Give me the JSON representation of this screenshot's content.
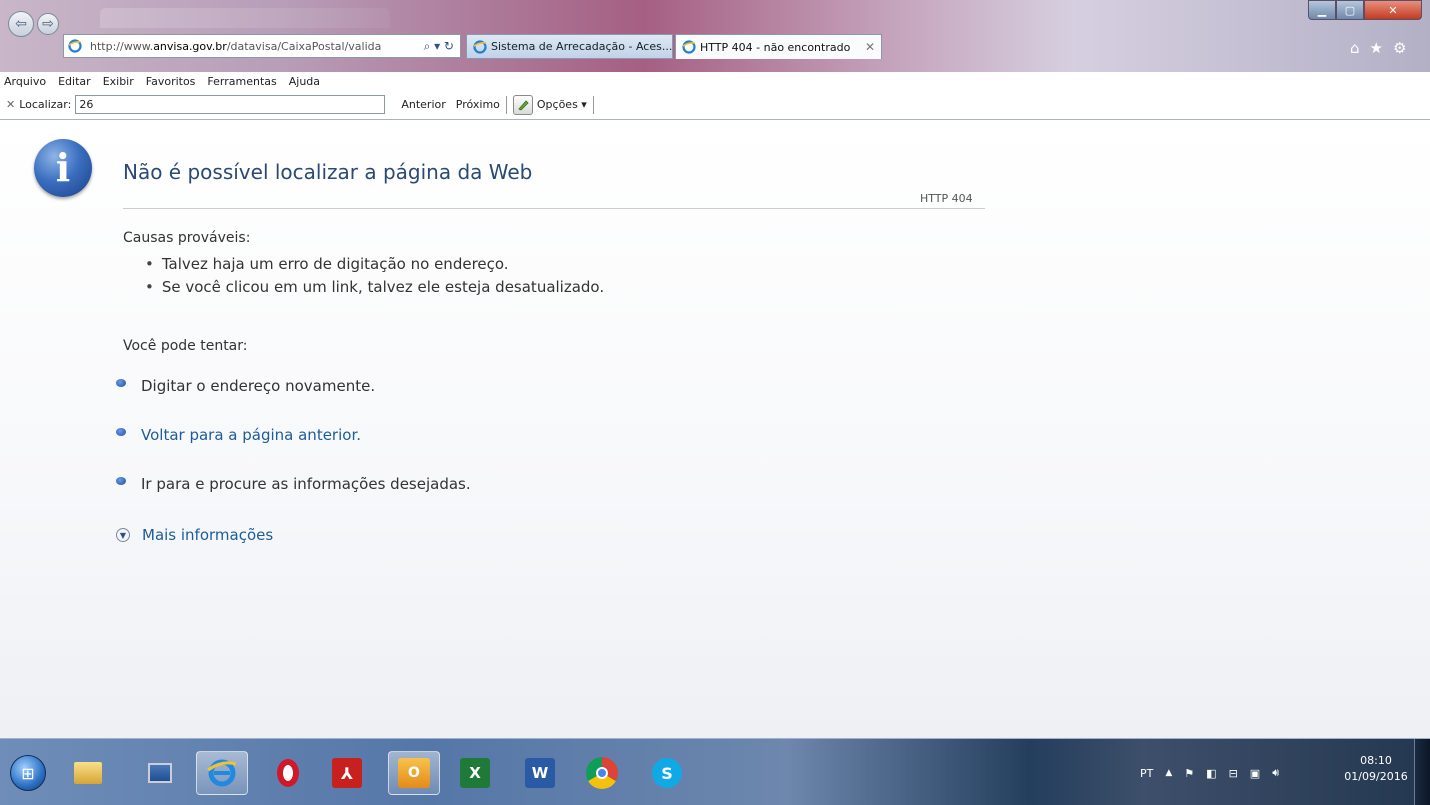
{
  "browser": {
    "address_url_prefix": "http://www.",
    "address_url_domain": "anvisa.gov.br",
    "address_url_path": "/datavisa/CaixaPostal/valida",
    "address_controls": "⌕ ▾ ↻",
    "tabs": [
      {
        "title": "Sistema de Arrecadação - Aces...",
        "active": false
      },
      {
        "title": "HTTP 404 - não encontrado",
        "active": true
      }
    ],
    "tab_close_glyph": "✕",
    "toolbar_icons": [
      "home-icon",
      "favorites-star-icon",
      "tools-gear-icon"
    ]
  },
  "menu": {
    "items": [
      "Arquivo",
      "Editar",
      "Exibir",
      "Favoritos",
      "Ferramentas",
      "Ajuda"
    ]
  },
  "findbar": {
    "label": "Localizar:",
    "value": "26",
    "previous": "Anterior",
    "next": "Próximo",
    "options": "Opções ▾"
  },
  "error_page": {
    "title": "Não é possível localizar a página da Web",
    "code": "HTTP 404",
    "causes_label": "Causas prováveis:",
    "causes": [
      "Talvez haja um erro de digitação no endereço.",
      "Se você clicou em um link, talvez ele esteja desatualizado."
    ],
    "try_label": "Você pode tentar:",
    "options": [
      {
        "text": "Digitar o endereço novamente.",
        "link": false
      },
      {
        "text": "Voltar para a página anterior.",
        "link": true
      },
      {
        "text": "Ir para  e procure as informações desejadas.",
        "link": false
      }
    ],
    "more_info": "Mais informações"
  },
  "taskbar": {
    "apps": [
      "start-icon",
      "file-explorer-icon",
      "desktop-icon",
      "internet-explorer-icon",
      "opera-icon",
      "adobe-reader-icon",
      "outlook-icon",
      "excel-icon",
      "word-icon",
      "chrome-icon",
      "skype-icon"
    ],
    "tray_language": "PT",
    "tray_icons": [
      "show-hidden-icons-icon",
      "action-center-flag-icon",
      "security-icon",
      "network-icon",
      "antivirus-icon",
      "volume-icon"
    ],
    "time": "08:10",
    "date": "01/09/2016"
  },
  "colors": {
    "link": "#1d5c9a",
    "title": "#2a4a74",
    "info_icon": "#2c5fb0"
  }
}
